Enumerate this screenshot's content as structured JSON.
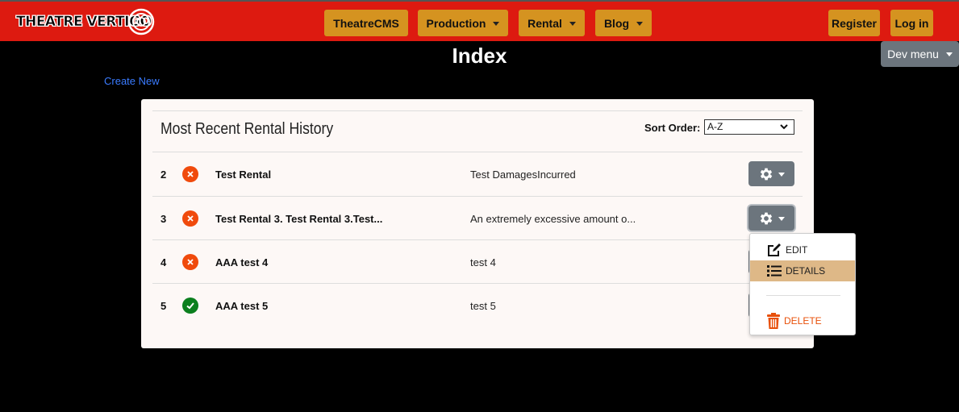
{
  "brand": {
    "name": "THEATRE VERTIGO"
  },
  "nav": {
    "items": [
      {
        "label": "TheatreCMS"
      },
      {
        "label": "Production"
      },
      {
        "label": "Rental"
      },
      {
        "label": "Blog"
      }
    ],
    "register": "Register",
    "login": "Log in",
    "dev_menu": "Dev menu"
  },
  "page": {
    "title": "Index",
    "create_new": "Create New"
  },
  "card": {
    "title": "Most Recent Rental History",
    "sort_label": "Sort Order:",
    "sort_value": "A-Z"
  },
  "rows": [
    {
      "id": "2",
      "status": "damaged",
      "title": "Test Rental",
      "description": "Test DamagesIncurred"
    },
    {
      "id": "3",
      "status": "damaged",
      "title": "Test Rental 3. Test Rental 3.Test...",
      "description": "An extremely excessive amount o..."
    },
    {
      "id": "4",
      "status": "damaged",
      "title": "AAA test 4",
      "description": "test 4"
    },
    {
      "id": "5",
      "status": "ok",
      "title": "AAA test 5",
      "description": "test 5"
    }
  ],
  "dropdown": {
    "edit": "EDIT",
    "details": "DETAILS",
    "delete": "DELETE"
  },
  "icons": {
    "status_bad": "x-circle-icon",
    "status_ok": "check-circle-icon",
    "actions": "gear-icon",
    "edit": "edit-icon",
    "details": "list-icon",
    "delete": "trash-icon"
  },
  "colors": {
    "navbar": "#dd1a10",
    "nav_button": "#d59320",
    "secondary": "#6c757d",
    "danger": "#f04a0c",
    "success": "#0b7f1e",
    "highlight": "#deb887",
    "link": "#3a7bff"
  }
}
